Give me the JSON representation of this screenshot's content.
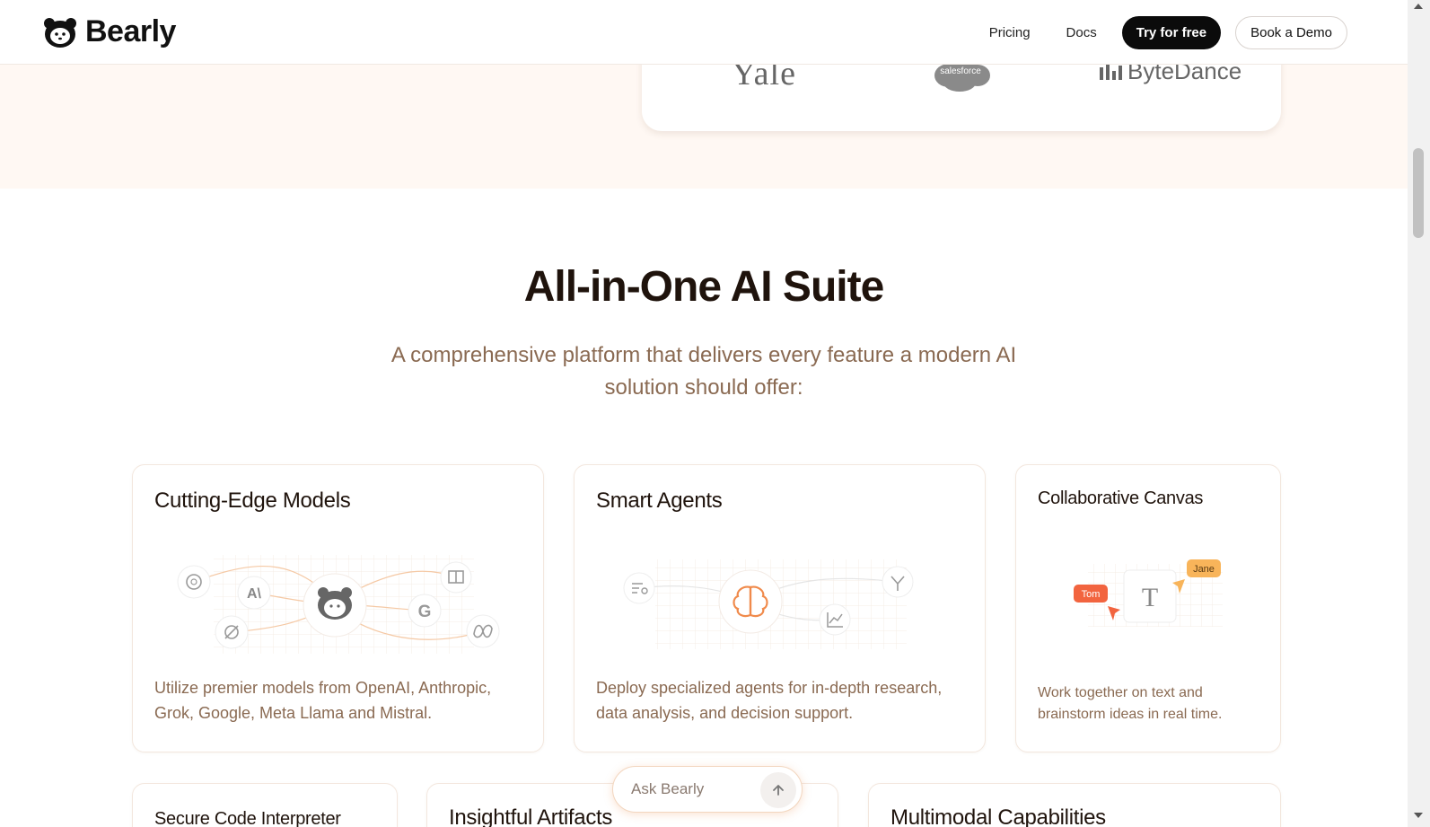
{
  "header": {
    "brand": "Bearly",
    "nav": {
      "pricing": "Pricing",
      "docs": "Docs",
      "try_free": "Try for free",
      "book_demo": "Book a Demo"
    }
  },
  "trusted_logos": {
    "yale": "Yale",
    "salesforce": "salesforce",
    "bytedance": "ByteDance"
  },
  "section": {
    "title": "All-in-One AI Suite",
    "subtitle": "A comprehensive platform that delivers every feature a modern AI solution should offer:"
  },
  "cards": [
    {
      "title": "Cutting-Edge Models",
      "description": "Utilize premier models from OpenAI, Anthropic, Grok, Google, Meta Llama and Mistral."
    },
    {
      "title": "Smart Agents",
      "description": "Deploy specialized agents for in-depth research, data analysis, and decision support."
    },
    {
      "title": "Collaborative Canvas",
      "description": "Work together on text and brainstorm ideas in real time.",
      "user_a": "Tom",
      "user_b": "Jane",
      "canvas_letter": "T"
    },
    {
      "title": "Secure Code Interpreter"
    },
    {
      "title": "Insightful Artifacts"
    },
    {
      "title": "Multimodal Capabilities"
    }
  ],
  "ask_bar": {
    "placeholder": "Ask Bearly"
  },
  "colors": {
    "accent_orange": "#f08a4b",
    "text_brown": "#8a6a52",
    "band_bg": "#fff8f3",
    "primary_dark": "#0b0b0b"
  }
}
